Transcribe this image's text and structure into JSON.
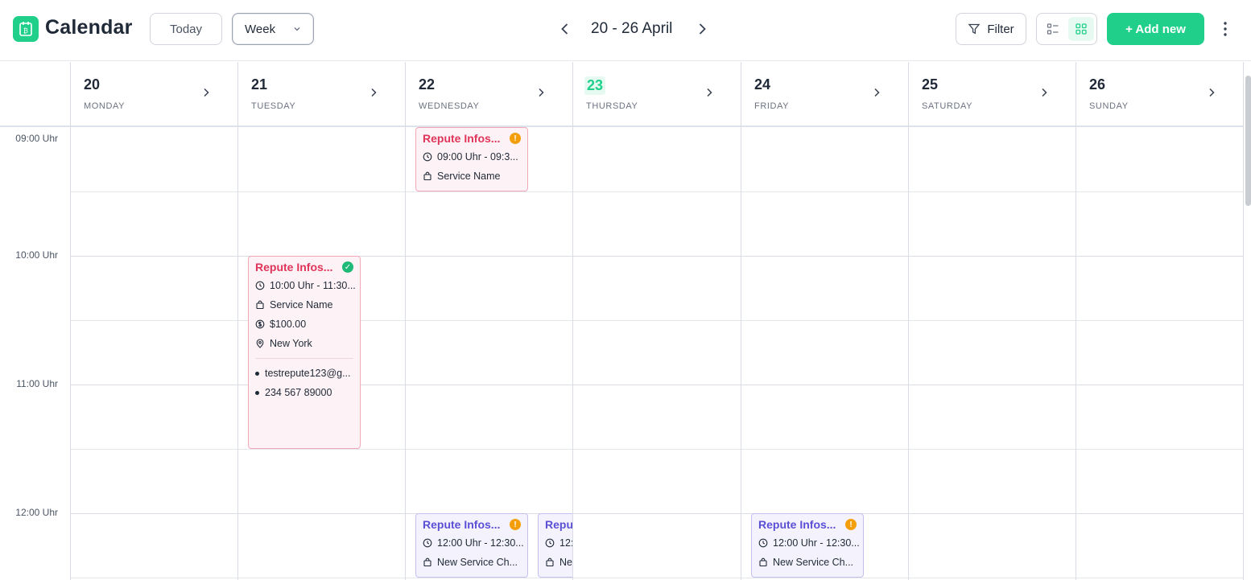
{
  "header": {
    "app_title": "Calendar",
    "today_label": "Today",
    "view_selected": "Week",
    "date_range": "20 - 26 April",
    "filter_label": "Filter",
    "add_new_label": "+ Add new",
    "accent_color": "#1fcf8a"
  },
  "days": [
    {
      "num": "20",
      "name": "MONDAY"
    },
    {
      "num": "21",
      "name": "TUESDAY"
    },
    {
      "num": "22",
      "name": "WEDNESDAY"
    },
    {
      "num": "23",
      "name": "THURSDAY",
      "is_today": true
    },
    {
      "num": "24",
      "name": "FRIDAY"
    },
    {
      "num": "25",
      "name": "SATURDAY"
    },
    {
      "num": "26",
      "name": "SUNDAY"
    }
  ],
  "time_labels": [
    "09:00 Uhr",
    "10:00 Uhr",
    "11:00 Uhr",
    "12:00 Uhr"
  ],
  "events": [
    {
      "title": "Repute Infos...",
      "status": "warning",
      "time": "09:00 Uhr - 09:3...",
      "service": "Service Name"
    },
    {
      "title": "Repute Infos...",
      "status": "confirmed",
      "time": "10:00 Uhr - 11:30...",
      "service": "Service Name",
      "price": "$100.00",
      "location": "New York",
      "email": "testrepute123@g...",
      "phone": "234 567 89000"
    },
    {
      "title": "Repute Infos...",
      "status": "warning",
      "time": "12:00 Uhr - 12:30...",
      "service": "New Service Ch..."
    },
    {
      "title": "Repu",
      "time": "12:",
      "service": "Ne"
    },
    {
      "title": "Repute Infos...",
      "status": "warning",
      "time": "12:00 Uhr - 12:30...",
      "service": "New Service Ch..."
    }
  ]
}
